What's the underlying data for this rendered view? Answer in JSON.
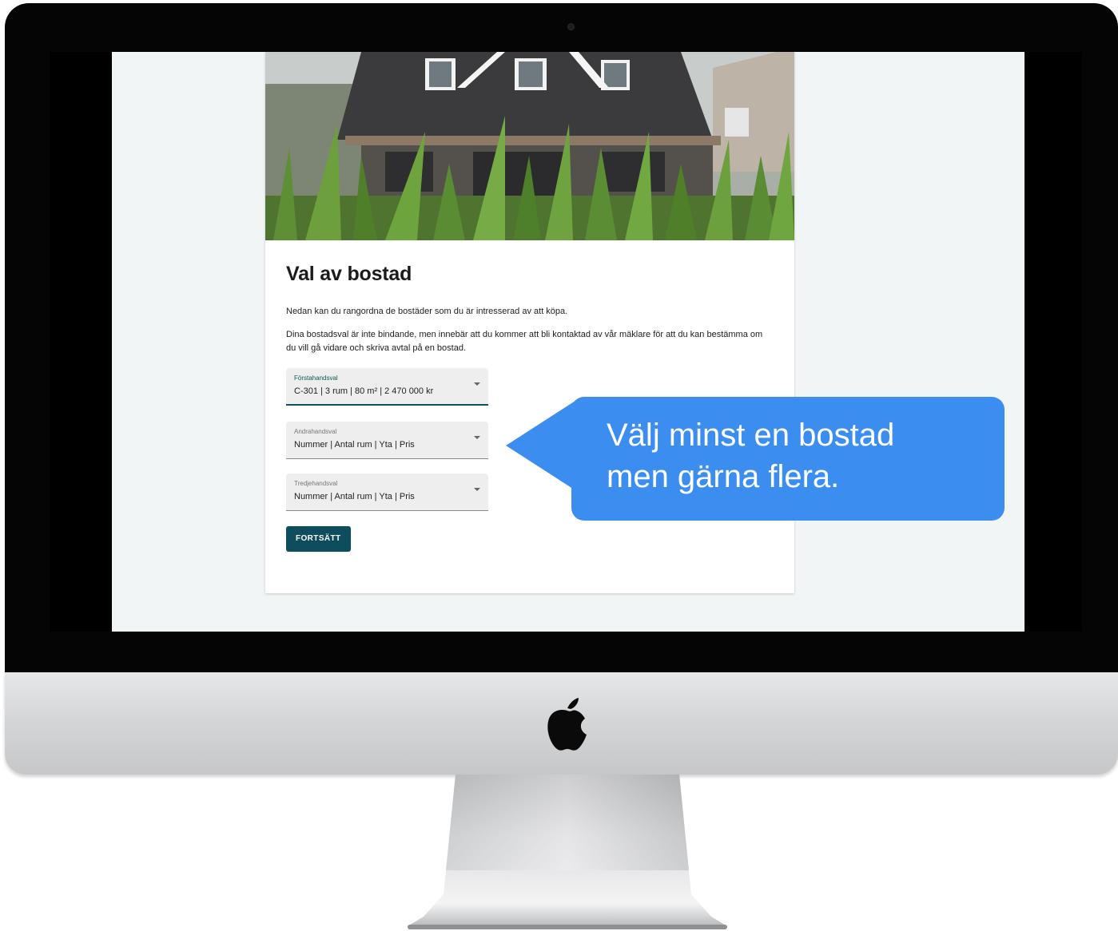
{
  "page": {
    "title": "Val av bostad",
    "intro": "Nedan kan du rangordna de bostäder som du är intresserad av att köpa.",
    "description": "Dina bostadsval är inte bindande, men innebär att du kommer att bli kontaktad av vår mäklare för att du kan bestämma om du vill gå vidare och skriva avtal på en bostad."
  },
  "form": {
    "first_choice": {
      "label": "Förstahandsval",
      "value": "C-301 | 3 rum | 80 m² | 2 470 000 kr"
    },
    "second_choice": {
      "label": "Andrahandsval",
      "value": "Nummer | Antal rum | Yta | Pris"
    },
    "third_choice": {
      "label": "Tredjehandsval",
      "value": "Nummer | Antal rum | Yta | Pris"
    },
    "continue_label": "FORTSÄTT"
  },
  "callout": {
    "line1": "Välj minst en bostad",
    "line2": "men gärna flera."
  },
  "colors": {
    "accent": "#0e4d5d",
    "callout": "#3b8ef0",
    "page_bg": "#f2f5f5"
  },
  "icons": {
    "dropdown": "chevron-down-icon",
    "brand": "apple-logo-icon",
    "camera": "camera-icon"
  }
}
